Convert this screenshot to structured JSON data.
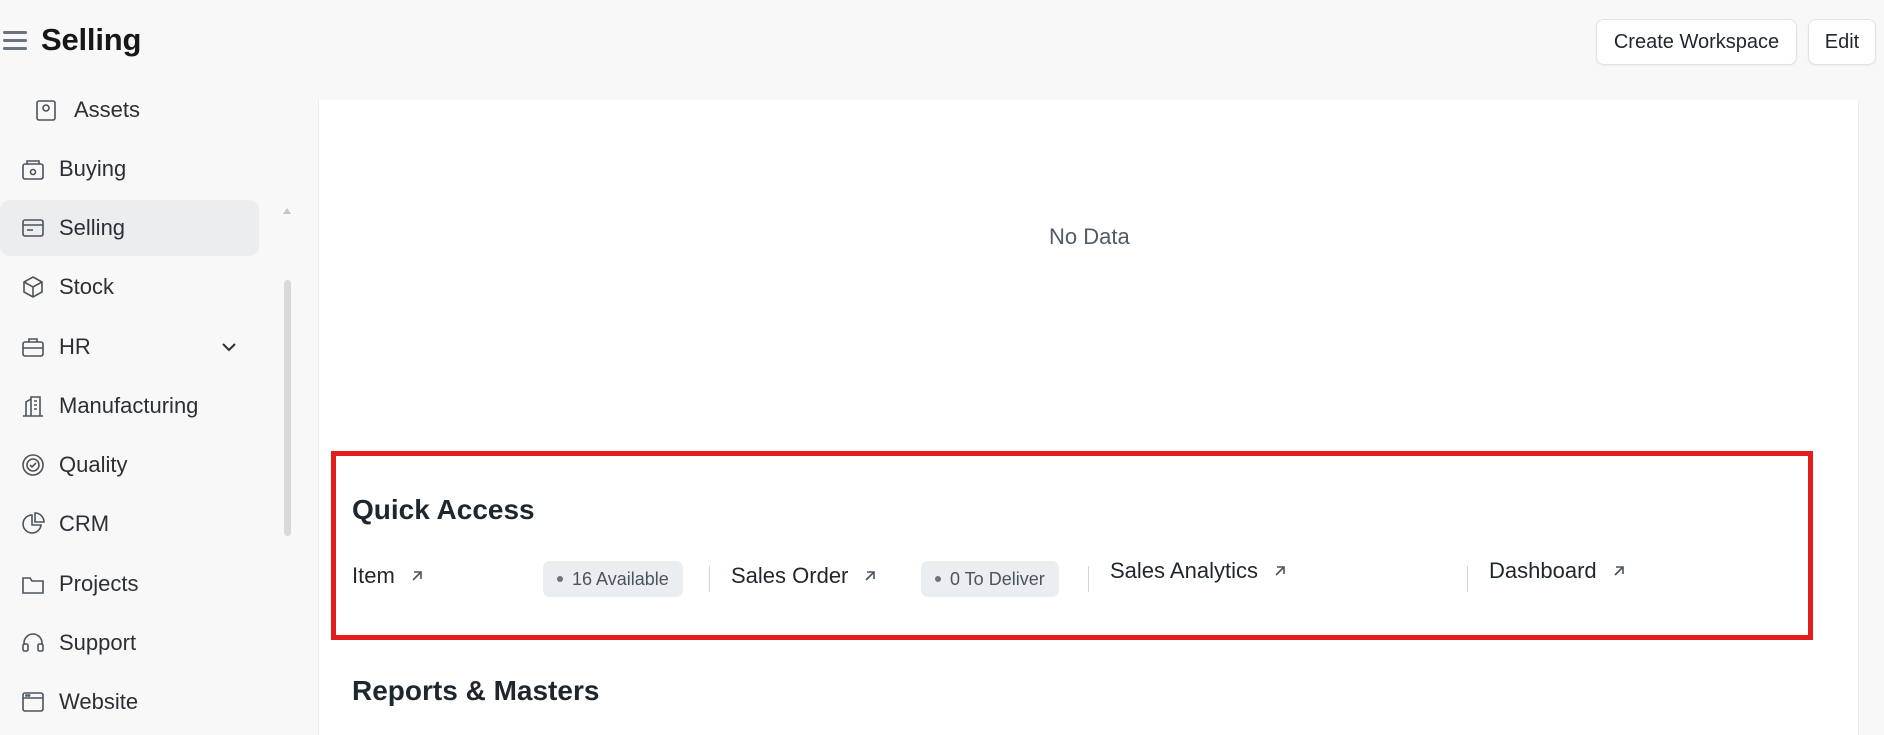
{
  "header": {
    "title": "Selling",
    "create_workspace_label": "Create Workspace",
    "edit_label": "Edit"
  },
  "sidebar": {
    "items": [
      {
        "label": "Assets",
        "icon": "assets-icon"
      },
      {
        "label": "Buying",
        "icon": "buying-icon"
      },
      {
        "label": "Selling",
        "icon": "selling-icon",
        "active": true
      },
      {
        "label": "Stock",
        "icon": "stock-icon"
      },
      {
        "label": "HR",
        "icon": "hr-icon",
        "has_children": true
      },
      {
        "label": "Manufacturing",
        "icon": "manufacturing-icon"
      },
      {
        "label": "Quality",
        "icon": "quality-icon"
      },
      {
        "label": "CRM",
        "icon": "crm-icon"
      },
      {
        "label": "Projects",
        "icon": "projects-icon"
      },
      {
        "label": "Support",
        "icon": "support-icon"
      },
      {
        "label": "Website",
        "icon": "website-icon"
      }
    ]
  },
  "main": {
    "chart_empty_text": "No Data",
    "quick_access": {
      "title": "Quick Access",
      "links": [
        {
          "label": "Item",
          "badge": "16 Available"
        },
        {
          "label": "Sales Order",
          "badge": "0 To Deliver"
        },
        {
          "label": "Sales Analytics"
        },
        {
          "label": "Dashboard"
        }
      ]
    },
    "reports_title": "Reports & Masters"
  },
  "colors": {
    "highlight_border": "#e31c1c",
    "active_item_bg": "#ebedef",
    "badge_bg": "#ebeef0"
  }
}
